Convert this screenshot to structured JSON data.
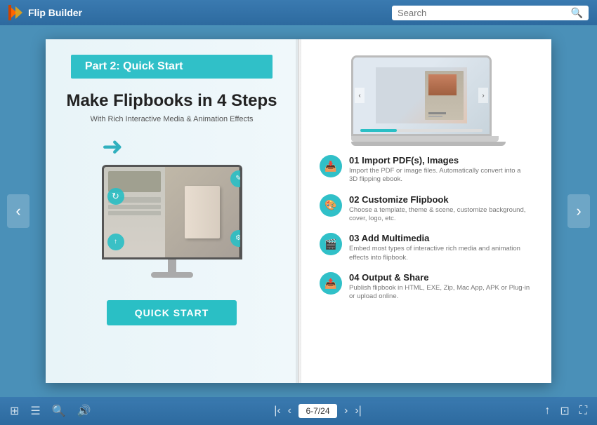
{
  "app": {
    "name": "Flip Builder"
  },
  "search": {
    "placeholder": "Search"
  },
  "book": {
    "left_page": {
      "part_label": "Part 2: Quick Start",
      "title": "Make Flipbooks in 4 Steps",
      "subtitle": "With Rich Interactive Media & Animation Effects",
      "quick_start_btn": "QUICK START"
    },
    "right_page": {
      "steps": [
        {
          "number": "01",
          "title": "Import PDF(s), Images",
          "desc": "Import the PDF or image files. Automatically convert into a 3D flipping ebook.",
          "icon": "📥"
        },
        {
          "number": "02",
          "title": "Customize Flipbook",
          "desc": "Choose a template, theme & scene, customize background, cover, logo, etc.",
          "icon": "🎨"
        },
        {
          "number": "03",
          "title": "Add Multimedia",
          "desc": "Embed most types of interactive rich media and animation effects into flipbook.",
          "icon": "🎬"
        },
        {
          "number": "04",
          "title": "Output & Share",
          "desc": "Publish flipbook in HTML, EXE, Zip, Mac App, APK or Plug-in or upload online.",
          "icon": "📤"
        }
      ]
    }
  },
  "navigation": {
    "prev_label": "‹",
    "next_label": "›",
    "page_indicator": "6-7/24",
    "first_label": "|‹",
    "last_label": "›|",
    "prev_page": "‹",
    "next_page": "›",
    "edge_left": "|‹",
    "edge_right": "›|"
  },
  "bottom_toolbar": {
    "grid_icon": "⊞",
    "list_icon": "☰",
    "zoom_icon": "🔍",
    "sound_icon": "🔊",
    "share_icon": "↑",
    "bookmark_icon": "⊡",
    "fullscreen_icon": "⛶"
  },
  "colors": {
    "teal": "#2abfc5",
    "header_bg": "#2d6a9f",
    "page_left_bg": "#eef6fa",
    "page_right_bg": "#ffffff"
  }
}
